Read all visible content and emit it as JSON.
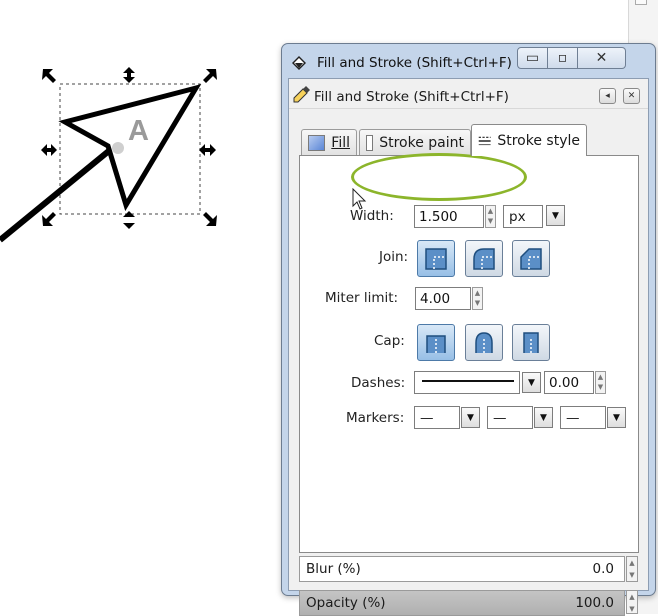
{
  "window": {
    "title": "Fill and Stroke (Shift+Ctrl+F)",
    "minimize_glyph": "▭",
    "maximize_glyph": "▫",
    "close_glyph": "✕"
  },
  "dock": {
    "title": "Fill and Stroke (Shift+Ctrl+F)",
    "arrow_glyph": "◂",
    "close_glyph": "✕"
  },
  "tabs": [
    {
      "label": "Fill",
      "icon": "fill-swatch-icon"
    },
    {
      "label": "Stroke paint",
      "icon": "stroke-swatch-icon"
    },
    {
      "label": "Stroke style",
      "icon": "stroke-style-icon",
      "active": true
    }
  ],
  "stroke_style": {
    "width_label": "Width:",
    "width_value": "1.500",
    "unit": "px",
    "join_label": "Join:",
    "join_options": [
      "miter-join",
      "round-join",
      "bevel-join"
    ],
    "join_selected": "miter-join",
    "miter_label": "Miter limit:",
    "miter_value": "4.00",
    "cap_label": "Cap:",
    "cap_options": [
      "butt-cap",
      "round-cap",
      "square-cap"
    ],
    "cap_selected": "butt-cap",
    "dashes_label": "Dashes:",
    "dash_offset": "0.00",
    "markers_label": "Markers:",
    "marker_start": "—",
    "marker_mid": "—",
    "marker_end": "—"
  },
  "filters": {
    "blur_label": "Blur (%)",
    "blur_value": "0.0",
    "opacity_label": "Opacity (%)",
    "opacity_value": "100.0"
  },
  "canvas": {
    "object_letter": "A"
  },
  "colors": {
    "highlight": "#8cb52b",
    "selected_button": "#97bfe6"
  }
}
